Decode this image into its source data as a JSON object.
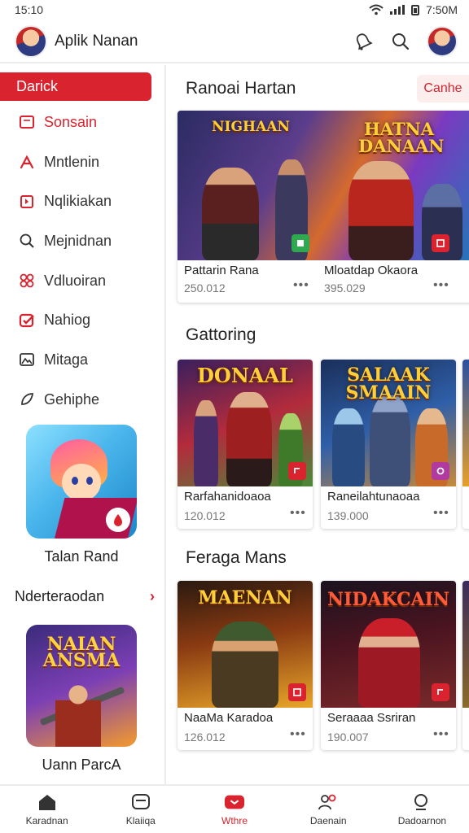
{
  "status": {
    "time": "15:10",
    "clock": "7:50M"
  },
  "header": {
    "title": "Aplik Nanan"
  },
  "sidebar": {
    "active_label": "Darick",
    "items": [
      {
        "label": "Sonsain",
        "icon": "tablet-icon",
        "red": true
      },
      {
        "label": "Mntlenin",
        "icon": "figure-icon",
        "red": false
      },
      {
        "label": "Nqlikiakan",
        "icon": "bookmark-icon",
        "red": false
      },
      {
        "label": "Mejnidnan",
        "icon": "search-icon",
        "red": false
      },
      {
        "label": "Vdluoiran",
        "icon": "puzzle-icon",
        "red": false
      },
      {
        "label": "Nahiog",
        "icon": "check-icon",
        "red": false
      },
      {
        "label": "Mitaga",
        "icon": "image-icon",
        "red": false
      },
      {
        "label": "Gehiphe",
        "icon": "leaf-icon",
        "red": false
      }
    ],
    "promo_caption": "Talan Rand",
    "more_label": "Nderteraodan",
    "promo2_logo": "NAIAN ANSMA",
    "promo2_caption": "Uann ParcA"
  },
  "main": {
    "section1": {
      "title": "Ranoai Hartan",
      "filter": "Canhe",
      "card": {
        "logo_left": "NIGHAAN",
        "logo_right": "HATNA DANAAN",
        "left_title": "Pattarin Rana",
        "left_meta": "250.012",
        "right_title": "Mloatdap Okaora",
        "right_meta": "395.029"
      }
    },
    "section2": {
      "title": "Gattoring",
      "cards": [
        {
          "logo": "DONAAL",
          "title": "Rarfahanidoaoa",
          "meta": "120.012"
        },
        {
          "logo": "SALAAK SMAAIN",
          "title": "Raneilahtunaoaa",
          "meta": "139.000"
        }
      ]
    },
    "section3": {
      "title": "Feraga Mans",
      "cards": [
        {
          "logo": "MAENAN",
          "title": "NaaMa Karadoa",
          "meta": "126.012"
        },
        {
          "logo": "NIDAKCAIN",
          "title": "Seraaaa Ssriran",
          "meta": "190.007"
        }
      ]
    }
  },
  "bottom_nav": [
    {
      "label": "Karadnan",
      "icon": "home-icon",
      "active": false
    },
    {
      "label": "Klaiiqa",
      "icon": "chat-icon",
      "active": false
    },
    {
      "label": "Wthre",
      "icon": "play-icon",
      "active": true
    },
    {
      "label": "Daenain",
      "icon": "people-icon",
      "active": false
    },
    {
      "label": "Dadoarnon",
      "icon": "search-icon",
      "active": false
    }
  ],
  "colors": {
    "accent": "#d9232e",
    "active_bg": "#d9232e",
    "chip_bg": "#fdeeee"
  }
}
